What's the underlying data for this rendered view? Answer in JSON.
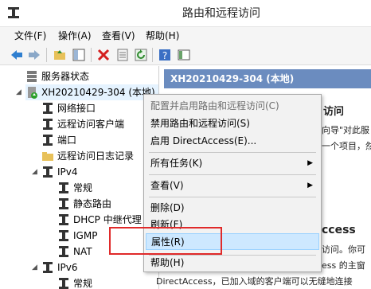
{
  "window": {
    "title": "路由和远程访问"
  },
  "menubar": {
    "items": [
      "文件(F)",
      "操作(A)",
      "查看(V)",
      "帮助(H)"
    ]
  },
  "toolbar": {
    "icons": [
      "back-icon",
      "forward-icon",
      "up-folder-icon",
      "show-tree-icon",
      "delete-icon",
      "properties-icon",
      "refresh-icon",
      "help-icon",
      "console-icon"
    ]
  },
  "tree": {
    "server_status": "服务器状态",
    "server": "XH20210429-304 (本地)",
    "items": {
      "network_interfaces": "网络接口",
      "remote_clients": "远程访问客户端",
      "ports": "端口",
      "remote_log": "远程访问日志记录",
      "ipv4": "IPv4",
      "general": "常规",
      "static_routes": "静态路由",
      "dhcp": "DHCP 中继代理",
      "igmp": "IGMP",
      "nat": "NAT",
      "ipv6": "IPv6",
      "ipv6_general": "常规"
    }
  },
  "right": {
    "header": "XH20210429-304 (本地)",
    "line1": "访问",
    "line2": "向导\"对此服",
    "line3": "一个项目，然",
    "big": "ccess",
    "line4": "访问。你可",
    "line5": "ess 的主窗",
    "line6": "DirectAccess，已加入域的客户端可以无缝地连接"
  },
  "context_menu": {
    "configure": "配置并启用路由和远程访问(C)",
    "disable": "禁用路由和远程访问(S)",
    "enable_da": "启用 DirectAccess(E)...",
    "all_tasks": "所有任务(K)",
    "view": "查看(V)",
    "delete": "删除(D)",
    "refresh": "刷新(F)",
    "properties": "属性(R)",
    "help": "帮助(H)"
  },
  "colors": {
    "header_bg": "#6b8cbf",
    "highlight_bg": "#cde8ff",
    "callout_red": "#e02a2a"
  }
}
